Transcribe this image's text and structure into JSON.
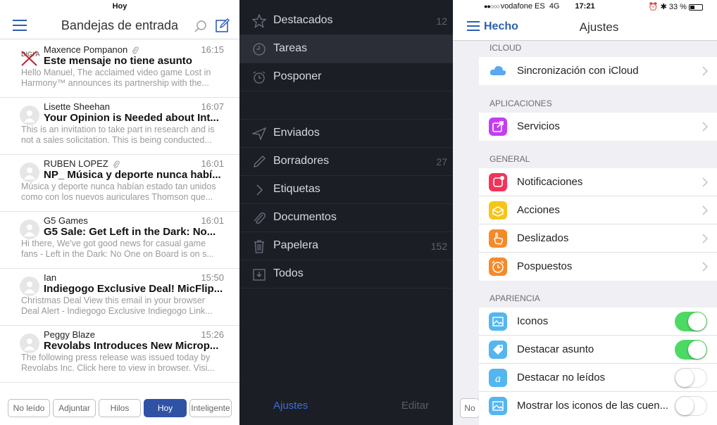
{
  "inbox": {
    "status_text": "Hoy",
    "title": "Bandejas de entrada",
    "emails": [
      {
        "from": "Maxence Pompanon",
        "time": "16:15",
        "subject": "Este mensaje no tiene asunto",
        "preview": "Hello Manuel, The acclaimed video game Lost in Harmony™ announces its partnership with the...",
        "attachment": true
      },
      {
        "from": "Lisette Sheehan",
        "time": "16:07",
        "subject": "Your Opinion is Needed about Int...",
        "preview": "This is an invitation to take part in research and is not a sales solicitation. This is being conducted...",
        "attachment": false
      },
      {
        "from": "RUBEN LOPEZ",
        "time": "16:01",
        "subject": "NP_ Música y deporte nunca habí...",
        "preview": "Música y deporte nunca habían estado tan unidos como con los nuevos auriculares Thomson que...",
        "attachment": true
      },
      {
        "from": "G5 Games",
        "time": "16:01",
        "subject": "G5 Sale: Get Left in the Dark: No...",
        "preview": "Hi there, We've got good news for casual game fans - Left in the Dark: No One on Board is on s...",
        "attachment": false
      },
      {
        "from": "Ian",
        "time": "15:50",
        "subject": "Indiegogo Exclusive Deal! MicFlip...",
        "preview": "Christmas Deal View this email in your browser Deal Alert - Indiegogo Exclusive Indiegogo Link...",
        "attachment": false
      },
      {
        "from": "Peggy Blaze",
        "time": "15:26",
        "subject": "Revolabs Introduces New Microp...",
        "preview": "The following press release was issued today by Revolabs Inc. Click here to view in browser. Visi...",
        "attachment": false
      }
    ],
    "tabs": [
      "No leído",
      "Adjuntar",
      "Hilos",
      "Hoy",
      "Inteligente"
    ],
    "active_tab": "Hoy",
    "avatar_logo_text": "DIGI ART"
  },
  "sidebar": {
    "items": [
      {
        "label": "Destacados",
        "count": "12",
        "icon": "star-icon"
      },
      {
        "label": "Tareas",
        "count": "",
        "icon": "clock-icon"
      },
      {
        "label": "Posponer",
        "count": "",
        "icon": "alarm-icon"
      },
      {
        "label": "Enviados",
        "count": "",
        "icon": "send-icon"
      },
      {
        "label": "Borradores",
        "count": "27",
        "icon": "pencil-icon"
      },
      {
        "label": "Etiquetas",
        "count": "",
        "icon": "chevron-right-icon"
      },
      {
        "label": "Documentos",
        "count": "",
        "icon": "paperclip-icon"
      },
      {
        "label": "Papelera",
        "count": "152",
        "icon": "trash-icon"
      },
      {
        "label": "Todos",
        "count": "",
        "icon": "archive-icon"
      }
    ],
    "selected": "Tareas",
    "footer_settings": "Ajustes",
    "footer_edit": "Editar"
  },
  "settings": {
    "status": {
      "carrier": "vodafone ES",
      "network": "4G",
      "time": "17:21",
      "battery": "33 %"
    },
    "done_label": "Hecho",
    "title": "Ajustes",
    "ghost_tab": "No",
    "sections": [
      {
        "header": "ICLOUD",
        "rows": [
          {
            "label": "Sincronización con iCloud",
            "icon": "cloud-icon",
            "color": "#5aa9f0"
          }
        ]
      },
      {
        "header": "APLICACIONES",
        "rows": [
          {
            "label": "Servicios",
            "icon": "share-icon",
            "color": "#c43ef0"
          }
        ]
      },
      {
        "header": "GENERAL",
        "rows": [
          {
            "label": "Notificaciones",
            "icon": "notification-icon",
            "color": "#f2335a"
          },
          {
            "label": "Acciones",
            "icon": "box-icon",
            "color": "#f5c518"
          },
          {
            "label": "Deslizados",
            "icon": "hand-icon",
            "color": "#f58a2a"
          },
          {
            "label": "Pospuestos",
            "icon": "alarm-clock-icon",
            "color": "#f58a2a"
          }
        ]
      },
      {
        "header": "APARIENCIA",
        "rows": [
          {
            "label": "Iconos",
            "icon": "image-icon",
            "color": "#54b6ef",
            "toggle": true
          },
          {
            "label": "Destacar asunto",
            "icon": "tag-icon",
            "color": "#54b6ef",
            "toggle": true
          },
          {
            "label": "Destacar no leídos",
            "icon": "letter-a-icon",
            "color": "#54b6ef",
            "toggle": false
          },
          {
            "label": "Mostrar los iconos de las cuen...",
            "icon": "image-icon",
            "color": "#54b6ef",
            "toggle": false
          }
        ]
      }
    ]
  },
  "colors": {
    "accent": "#2d5fb0",
    "active_tab": "#2f52a5",
    "sidebar_bg": "#1c1e26",
    "toggle_on": "#4cd964"
  }
}
